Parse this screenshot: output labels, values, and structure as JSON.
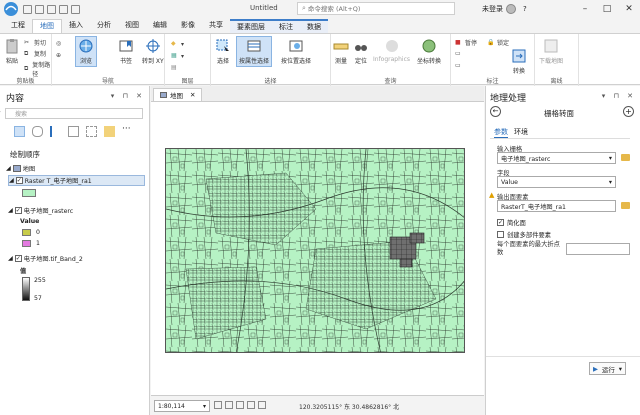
{
  "window": {
    "title": "Untitled",
    "search_placeholder": "命令搜索 (Alt+Q)",
    "user": "未登录",
    "help": "?"
  },
  "tabs": [
    {
      "label": "工程"
    },
    {
      "label": "地图"
    },
    {
      "label": "插入"
    },
    {
      "label": "分析"
    },
    {
      "label": "视图"
    },
    {
      "label": "编辑"
    },
    {
      "label": "影像"
    },
    {
      "label": "共享"
    },
    {
      "label": "要素图层"
    },
    {
      "label": "标注"
    },
    {
      "label": "数据"
    }
  ],
  "ribbon": {
    "clipboard": {
      "group": "剪贴板",
      "paste": "粘贴",
      "cut": "剪切",
      "copy": "复制",
      "copy_path": "复制路径"
    },
    "navigate": {
      "group": "导航",
      "explore": "浏览",
      "bookmarks": "书签",
      "goto": "转到 XY"
    },
    "layer": {
      "group": "图层"
    },
    "selection": {
      "group": "选择",
      "select": "选择",
      "by_attr": "按属性选择",
      "by_loc": "按位置选择"
    },
    "inquiry": {
      "group": "查询",
      "measure": "测量",
      "locate": "定位",
      "infographics": "Infographics",
      "coord": "坐标转换"
    },
    "labeling": {
      "group": "标注",
      "pause": "暂停",
      "lock": "锁定",
      "convert": "转换"
    },
    "offline": {
      "group": "离线",
      "download": "下载地图"
    }
  },
  "contents": {
    "title": "内容",
    "search_placeholder": "搜索",
    "drawing_order": "绘制顺序",
    "map": "地图",
    "layers": [
      {
        "name": "Raster T_电子地图_ra1",
        "swatch": "#b6f2c4"
      },
      {
        "name": "电子地图_rasterc",
        "field": "Value",
        "classes": [
          {
            "label": "0",
            "color": "#c7cc49"
          },
          {
            "label": "1",
            "color": "#e37ae0"
          }
        ]
      },
      {
        "name": "电子地图.tif_Band_2",
        "value_label": "值",
        "max": "255",
        "min": "57"
      }
    ]
  },
  "map": {
    "tab": "地图",
    "scale": "1:80,114",
    "coordinates": "120.3205115° 东 30.4862816° 北"
  },
  "geoprocessing": {
    "title": "地理处理",
    "tool": "栅格转面",
    "tab_params": "参数",
    "tab_env": "环境",
    "input_label": "输入栅格",
    "input_value": "电子地图_rasterc",
    "field_label": "字段",
    "field_value": "Value",
    "output_label": "输出面要素",
    "output_value": "RasterT_电子地图_ra1",
    "simplify": "简化面",
    "multipart": "创建多部件要素",
    "max_vertices": "每个面要素的最大折点数",
    "run": "运行"
  },
  "colors": {
    "map_fill": "#b6f2c4",
    "accent": "#2a6ebb"
  }
}
